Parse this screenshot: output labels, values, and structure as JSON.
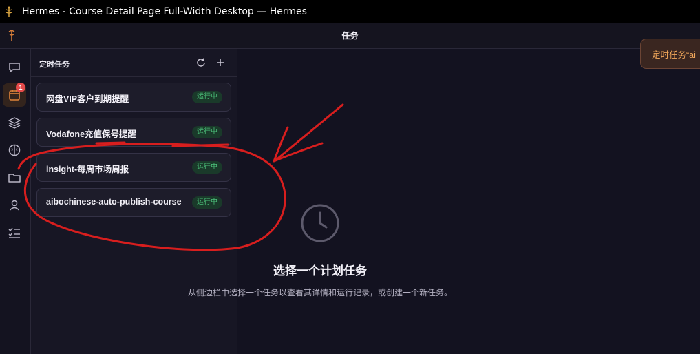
{
  "window": {
    "title": "Hermes - Course Detail Page Full-Width Desktop — Hermes",
    "app_icon": "caduceus-icon"
  },
  "header": {
    "title": "任务",
    "logo_icon": "caduceus-icon"
  },
  "rail": {
    "items": [
      {
        "name": "chat",
        "icon": "chat-icon"
      },
      {
        "name": "tasks",
        "icon": "calendar-icon",
        "active": true,
        "badge": "1"
      },
      {
        "name": "layers",
        "icon": "layers-icon"
      },
      {
        "name": "brain",
        "icon": "brain-icon"
      },
      {
        "name": "files",
        "icon": "folder-icon"
      },
      {
        "name": "profile",
        "icon": "user-icon"
      },
      {
        "name": "checklist",
        "icon": "checklist-icon"
      }
    ]
  },
  "sidebar": {
    "title": "定时任务",
    "refresh_icon": "refresh-icon",
    "add_icon": "plus-icon",
    "tasks": [
      {
        "name": "网盘VIP客户到期提醒",
        "status": "运行中"
      },
      {
        "name": "Vodafone充值保号提醒",
        "status": "运行中"
      },
      {
        "name": "insight-每周市场周报",
        "status": "运行中"
      },
      {
        "name": "aibochinese-auto-publish-course",
        "status": "运行中"
      }
    ]
  },
  "main": {
    "empty_icon": "clock-icon",
    "empty_title": "选择一个计划任务",
    "empty_description": "从侧边栏中选择一个任务以查看其详情和运行记录，或创建一个新任务。"
  },
  "toast": {
    "text": "定时任务“ai"
  },
  "colors": {
    "accent": "#e0833a",
    "status_green": "#4cc07a",
    "annotation_red": "#d81e1e",
    "badge_red": "#e44a4a"
  }
}
